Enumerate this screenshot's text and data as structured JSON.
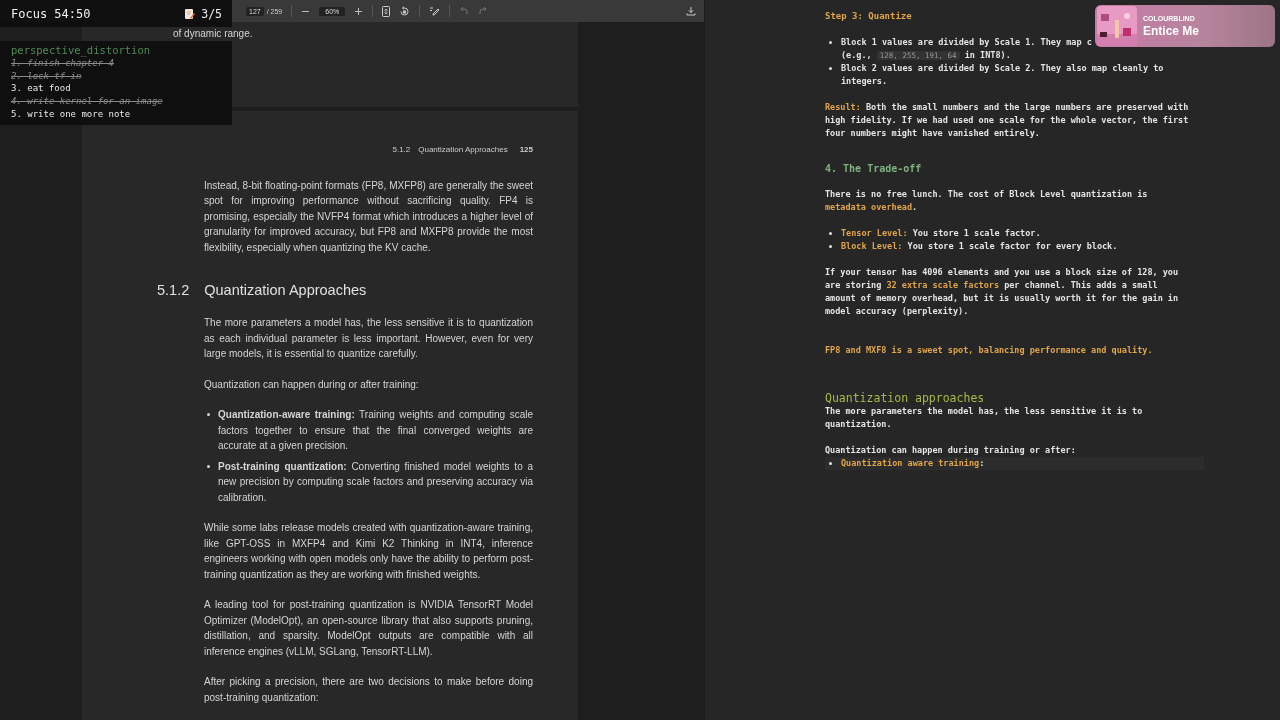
{
  "pdf_viewer": {
    "toolbar": {
      "page": "127",
      "page_count": "/ 259",
      "zoom": "60%",
      "history": [
        {
          "kind": "undo",
          "disabled": true
        },
        {
          "kind": "redo",
          "disabled": true
        }
      ]
    },
    "previous_page_tail": "of dynamic range.",
    "page": {
      "header_section": "5.1.2",
      "header_title": "Quantization Approaches",
      "header_page": "125",
      "blocks": [
        {
          "kind": "p",
          "text": "Instead, 8-bit floating-point formats (FP8, MXFP8) are generally the sweet spot for improving performance without sacrificing quality. FP4 is promising, especially the NVFP4 format which introduces a higher level of granularity for improved accuracy, but FP8 and MXFP8 provide the most flexibility, especially when quantizing the KV cache."
        },
        {
          "kind": "heading",
          "number": "5.1.2",
          "text": "Quantization Approaches"
        },
        {
          "kind": "p",
          "text": "The more parameters a model has, the less sensitive it is to quantization as each individual parameter is less important. However, even for very large models, it is essential to quantize carefully."
        },
        {
          "kind": "p",
          "text": "Quantization can happen during or after training:"
        },
        {
          "kind": "list",
          "items": [
            "**Quantization-aware training:** Training weights and computing scale factors together to ensure that the final converged weights are accurate at a given precision.",
            "**Post-training quantization:** Converting finished model weights to a new precision by computing scale factors and preserving accuracy via calibration."
          ]
        },
        {
          "kind": "p",
          "text": "While some labs release models created with quantization-aware training, like GPT-OSS in MXFP4 and Kimi K2 Thinking in INT4, inference engineers working with open models only have the ability to perform post-training quantization as they are working with finished weights."
        },
        {
          "kind": "p",
          "text": "A leading tool for post-training quantization is NVIDIA TensorRT Model Optimizer (ModelOpt), an open-source library that also supports pruning, distillation, and sparsity. ModelOpt outputs are compatible with all inference engines (vLLM, SGLang, TensorRT-LLM)."
        },
        {
          "kind": "p",
          "text": "After picking a precision, there are two decisions to make before doing post-training quantization:"
        }
      ]
    }
  },
  "focus_widget": {
    "timer": "Focus 54:50",
    "progress": "3/5",
    "list_title": "perspective_distortion",
    "tasks": [
      {
        "text": "1. finish chapter 4",
        "done": true
      },
      {
        "text": "2. lock tf in",
        "done": true
      },
      {
        "text": "3. eat food",
        "done": false
      },
      {
        "text": "4. write kernel for an image",
        "done": true
      },
      {
        "text": "5. write one more note",
        "done": false
      }
    ]
  },
  "notes": {
    "blocks": [
      {
        "kind": "step",
        "segments": [
          {
            "kind": "text",
            "text": "Step 3: Quantize"
          }
        ]
      },
      {
        "kind": "list",
        "items": [
          {
            "current": false,
            "segments": [
              {
                "kind": "text",
                "text": "Block 1 values are divided by Scale 1. They map c"
              },
              {
                "kind": "break"
              },
              {
                "kind": "text",
                "text": "(e.g., "
              },
              {
                "kind": "code",
                "text": "128, 255, 191, 64"
              },
              {
                "kind": "text",
                "text": " in INT8)."
              }
            ]
          },
          {
            "current": false,
            "segments": [
              {
                "kind": "text",
                "text": "Block 2 values are divided by Scale 2. They also map cleanly to integers."
              }
            ]
          }
        ]
      },
      {
        "kind": "p",
        "segments": [
          {
            "kind": "accent",
            "text": "Result:"
          },
          {
            "kind": "text",
            "text": " Both the small numbers and the large numbers are preserved with high fidelity. If we had used one scale for the whole vector, the first four numbers might have vanished entirely."
          }
        ]
      },
      {
        "kind": "section",
        "segments": [
          {
            "kind": "text",
            "text": "4. The Trade-off"
          }
        ]
      },
      {
        "kind": "p",
        "segments": [
          {
            "kind": "text",
            "text": "There is no free lunch. The cost of Block Level quantization is "
          },
          {
            "kind": "accent",
            "text": "metadata overhead"
          },
          {
            "kind": "text",
            "text": "."
          }
        ]
      },
      {
        "kind": "list",
        "items": [
          {
            "current": false,
            "segments": [
              {
                "kind": "accent",
                "text": "Tensor Level:"
              },
              {
                "kind": "text",
                "text": " You store 1 scale factor."
              }
            ]
          },
          {
            "current": false,
            "segments": [
              {
                "kind": "accent",
                "text": "Block Level:"
              },
              {
                "kind": "text",
                "text": " You store 1 scale factor for every block."
              }
            ]
          }
        ]
      },
      {
        "kind": "p",
        "segments": [
          {
            "kind": "text",
            "text": "If your tensor has 4096 elements and you use a block size of 128, you are storing "
          },
          {
            "kind": "accent",
            "text": "32 extra scale factors"
          },
          {
            "kind": "text",
            "text": " per channel. This adds a small amount of memory overhead, but it is usually worth it for the gain in model accuracy (perplexity)."
          }
        ]
      },
      {
        "kind": "callout",
        "segments": [
          {
            "kind": "accent",
            "text": "FP8 and MXF8 is a sweet spot, balancing performance and quality."
          }
        ]
      },
      {
        "kind": "title",
        "segments": [
          {
            "kind": "text",
            "text": "Quantization approaches"
          }
        ]
      },
      {
        "kind": "p",
        "segments": [
          {
            "kind": "text",
            "text": "The more parameters the model has, the less sensitive it is to quantization."
          }
        ]
      },
      {
        "kind": "p",
        "segments": [
          {
            "kind": "text",
            "text": "Quantization can happen during training or after:"
          }
        ],
        "items": [
          {
            "current": true,
            "segments": [
              {
                "kind": "accent",
                "text": "Quantization aware training"
              },
              {
                "kind": "text",
                "text": ":"
              }
            ]
          }
        ]
      }
    ]
  },
  "now_playing": {
    "artist": "COLOURBLIND",
    "title": "Entice Me"
  }
}
